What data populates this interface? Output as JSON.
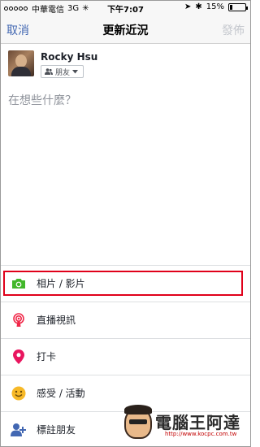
{
  "status_bar": {
    "carrier": "中華電信",
    "network": "3G",
    "time": "下午7:07",
    "battery": "15%",
    "signal_dots": 5
  },
  "nav": {
    "cancel": "取消",
    "title": "更新近況",
    "post": "發佈"
  },
  "composer": {
    "user_name": "Rocky Hsu",
    "audience": "朋友",
    "placeholder": "在想些什麼？"
  },
  "options": [
    {
      "label": "相片 / 影片",
      "icon": "camera-icon",
      "color": "#42b72a",
      "highlighted": true
    },
    {
      "label": "直播視訊",
      "icon": "live-video-icon",
      "color": "#f02849"
    },
    {
      "label": "打卡",
      "icon": "location-pin-icon",
      "color": "#e9165f"
    },
    {
      "label": "感受 / 活動",
      "icon": "smiley-icon",
      "color": "#f7b928"
    },
    {
      "label": "標註朋友",
      "icon": "tag-people-icon",
      "color": "#4267b2"
    }
  ],
  "watermark": {
    "logo": "電腦王阿達",
    "url": "http://www.kocpc.com.tw"
  },
  "colors": {
    "link_blue": "#4267b2",
    "disabled": "#c5c8ce",
    "highlight_box": "#e0001a"
  }
}
